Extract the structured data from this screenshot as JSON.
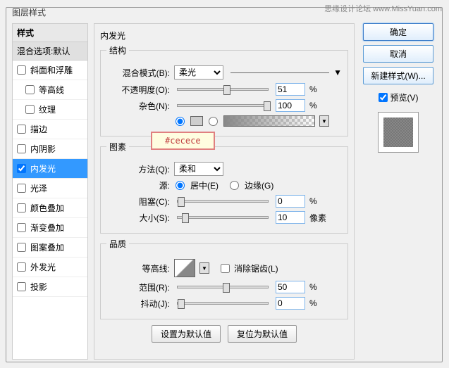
{
  "watermark": "思缘设计论坛  www.MissYuan.com",
  "dialog_title": "图层样式",
  "left": {
    "header": "样式",
    "blend_options": "混合选项:默认",
    "items": [
      {
        "label": "斜面和浮雕",
        "checked": false
      },
      {
        "label": "等高线",
        "checked": false,
        "indent": true
      },
      {
        "label": "纹理",
        "checked": false,
        "indent": true
      },
      {
        "label": "描边",
        "checked": false
      },
      {
        "label": "内阴影",
        "checked": false
      },
      {
        "label": "内发光",
        "checked": true,
        "selected": true
      },
      {
        "label": "光泽",
        "checked": false
      },
      {
        "label": "颜色叠加",
        "checked": false
      },
      {
        "label": "渐变叠加",
        "checked": false
      },
      {
        "label": "图案叠加",
        "checked": false
      },
      {
        "label": "外发光",
        "checked": false
      },
      {
        "label": "投影",
        "checked": false
      }
    ]
  },
  "center": {
    "title": "内发光",
    "structure": {
      "title": "结构",
      "blend_mode_label": "混合模式(B):",
      "blend_mode_value": "柔光",
      "opacity_label": "不透明度(O):",
      "opacity_value": "51",
      "opacity_unit": "%",
      "noise_label": "杂色(N):",
      "noise_value": "100",
      "noise_unit": "%",
      "color_hex": "#cecece"
    },
    "elements": {
      "title": "图素",
      "technique_label": "方法(Q):",
      "technique_value": "柔和",
      "source_label": "源:",
      "source_center": "居中(E)",
      "source_edge": "边缘(G)",
      "choke_label": "阻塞(C):",
      "choke_value": "0",
      "choke_unit": "%",
      "size_label": "大小(S):",
      "size_value": "10",
      "size_unit": "像素"
    },
    "quality": {
      "title": "品质",
      "contour_label": "等高线:",
      "antialias_label": "消除锯齿(L)",
      "range_label": "范围(R):",
      "range_value": "50",
      "range_unit": "%",
      "jitter_label": "抖动(J):",
      "jitter_value": "0",
      "jitter_unit": "%"
    },
    "btn_default": "设置为默认值",
    "btn_reset": "复位为默认值"
  },
  "right": {
    "ok": "确定",
    "cancel": "取消",
    "new_style": "新建样式(W)...",
    "preview": "预览(V)"
  }
}
